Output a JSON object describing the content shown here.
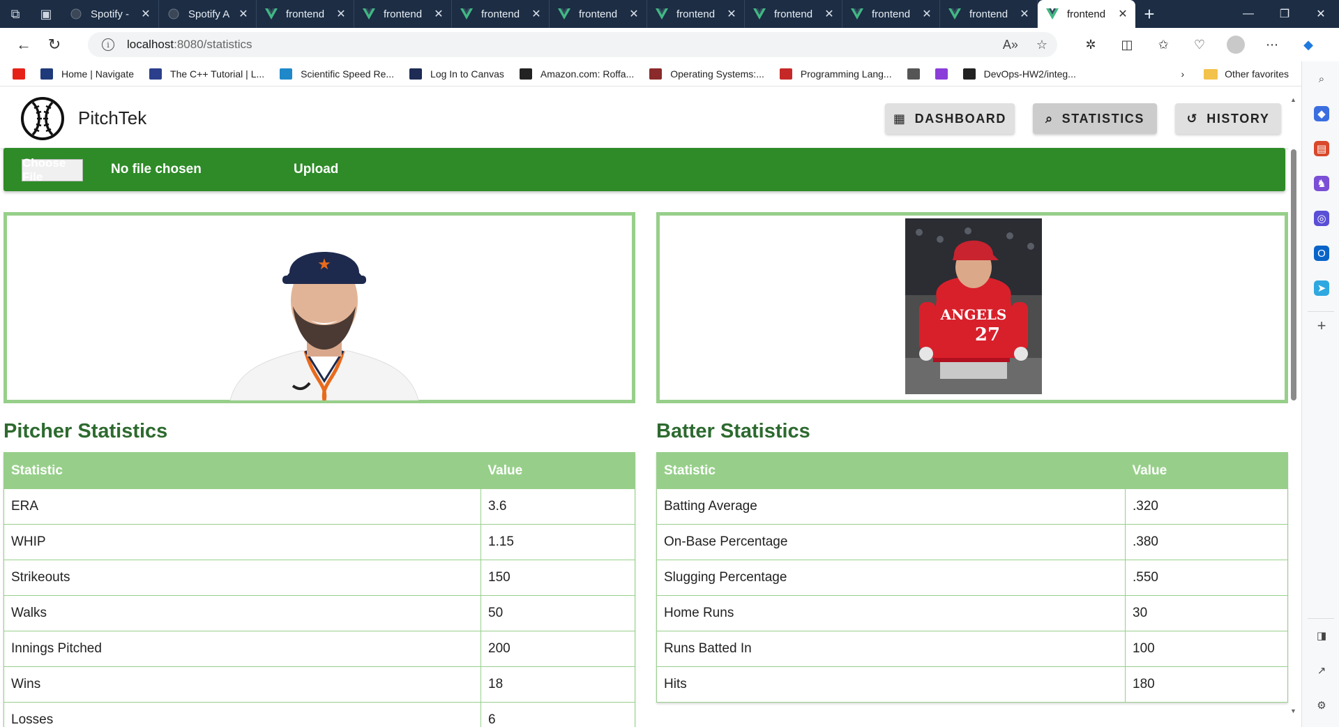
{
  "browser": {
    "tabs": [
      {
        "label": "Spotify -",
        "icon": "globe-icon"
      },
      {
        "label": "Spotify A",
        "icon": "globe-icon"
      },
      {
        "label": "frontend",
        "icon": "vue-icon"
      },
      {
        "label": "frontend",
        "icon": "vue-icon"
      },
      {
        "label": "frontend",
        "icon": "vue-icon"
      },
      {
        "label": "frontend",
        "icon": "vue-icon"
      },
      {
        "label": "frontend",
        "icon": "vue-icon"
      },
      {
        "label": "frontend",
        "icon": "vue-icon"
      },
      {
        "label": "frontend",
        "icon": "vue-icon"
      },
      {
        "label": "frontend",
        "icon": "vue-icon"
      },
      {
        "label": "frontend",
        "icon": "vue-icon",
        "active": true
      }
    ],
    "url_host": "localhost",
    "url_path": ":8080/statistics",
    "favorites": [
      {
        "label": "",
        "icon": "youtube-icon",
        "color": "#e62117"
      },
      {
        "label": "Home | Navigate",
        "icon": "navigate-icon",
        "color": "#1f3a7a"
      },
      {
        "label": "The C++ Tutorial | L...",
        "icon": "cpp-icon",
        "color": "#2b3f8c"
      },
      {
        "label": "Scientific Speed Re...",
        "icon": "speed-read-icon",
        "color": "#1e88c9"
      },
      {
        "label": "Log In to Canvas",
        "icon": "canvas-icon",
        "color": "#1d2b55"
      },
      {
        "label": "Amazon.com: Roffa...",
        "icon": "amazon-icon",
        "color": "#222222"
      },
      {
        "label": "Operating Systems:...",
        "icon": "crest-icon",
        "color": "#8a2a2a"
      },
      {
        "label": "Programming Lang...",
        "icon": "pdf-icon",
        "color": "#c62828"
      },
      {
        "label": "",
        "icon": "document-icon",
        "color": "#555555"
      },
      {
        "label": "",
        "icon": "play-icon",
        "color": "#8b3dd9"
      },
      {
        "label": "DevOps-HW2/integ...",
        "icon": "github-icon",
        "color": "#222222"
      }
    ],
    "other_favorites": "Other favorites"
  },
  "app": {
    "brand": "PitchTek",
    "nav": [
      {
        "label": "DASHBOARD",
        "icon": "dashboard-icon"
      },
      {
        "label": "STATISTICS",
        "icon": "search-icon",
        "active": true
      },
      {
        "label": "HISTORY",
        "icon": "history-icon"
      }
    ],
    "upload": {
      "choose_label": "Choose File",
      "no_file": "No file chosen",
      "upload_label": "Upload"
    },
    "pitcher": {
      "title": "Pitcher Statistics",
      "headers": [
        "Statistic",
        "Value"
      ],
      "rows": [
        [
          "ERA",
          "3.6"
        ],
        [
          "WHIP",
          "1.15"
        ],
        [
          "Strikeouts",
          "150"
        ],
        [
          "Walks",
          "50"
        ],
        [
          "Innings Pitched",
          "200"
        ],
        [
          "Wins",
          "18"
        ],
        [
          "Losses",
          "6"
        ]
      ]
    },
    "batter": {
      "title": "Batter Statistics",
      "headers": [
        "Statistic",
        "Value"
      ],
      "rows": [
        [
          "Batting Average",
          ".320"
        ],
        [
          "On-Base Percentage",
          ".380"
        ],
        [
          "Slugging Percentage",
          ".550"
        ],
        [
          "Home Runs",
          "30"
        ],
        [
          "Runs Batted In",
          "100"
        ],
        [
          "Hits",
          "180"
        ]
      ]
    },
    "colors": {
      "upload_bar": "#2e8b28",
      "frame": "#97cf8a",
      "title_green": "#2d6a2f"
    }
  }
}
